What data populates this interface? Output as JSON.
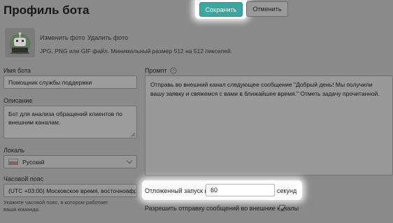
{
  "page": {
    "title": "Профиль бота"
  },
  "actions": {
    "save_label": "Сохранить",
    "cancel_label": "Отменить"
  },
  "photo": {
    "change_label": "Изменить фото",
    "delete_label": "Удалить фото",
    "hint": "JPG, PNG или GIF файл. Минимальный размер 512 на 512 пикселей.",
    "avatar_icon": "robot-laptop-icon"
  },
  "form": {
    "name_label": "Имя бота",
    "name_value": "Помощник службы поддержки",
    "description_label": "Описание",
    "description_value": "Бот для анализа обращений клиентов по внешним каналам.",
    "locale_label": "Локаль",
    "locale_value": "Русский",
    "timezone_label": "Часовой пояс",
    "timezone_value": "(UTC +03:00) Московское время, восточноафр...",
    "timezone_hint": "Укажите часовой пояс, в котором работает ваша команда."
  },
  "prompt": {
    "label": "Промпт",
    "help_icon": "question-circle-icon",
    "text": "Отправь во внешний канал следующее сообщение \"Добрый день! Мы получили вашу заявку и свяжемся с вами в ближайшее время.\" Отметь задачу прочитанной."
  },
  "delayed_start": {
    "label": "Отложенный запуск на",
    "value": "60",
    "unit": "секунд"
  },
  "external_messages": {
    "label": "Разрешить отправку сообщений во внешние каналы",
    "checked": true
  },
  "colors": {
    "accent": "#3aa89e",
    "overlay": "#8a8a8a",
    "highlight": "#ffffff"
  }
}
